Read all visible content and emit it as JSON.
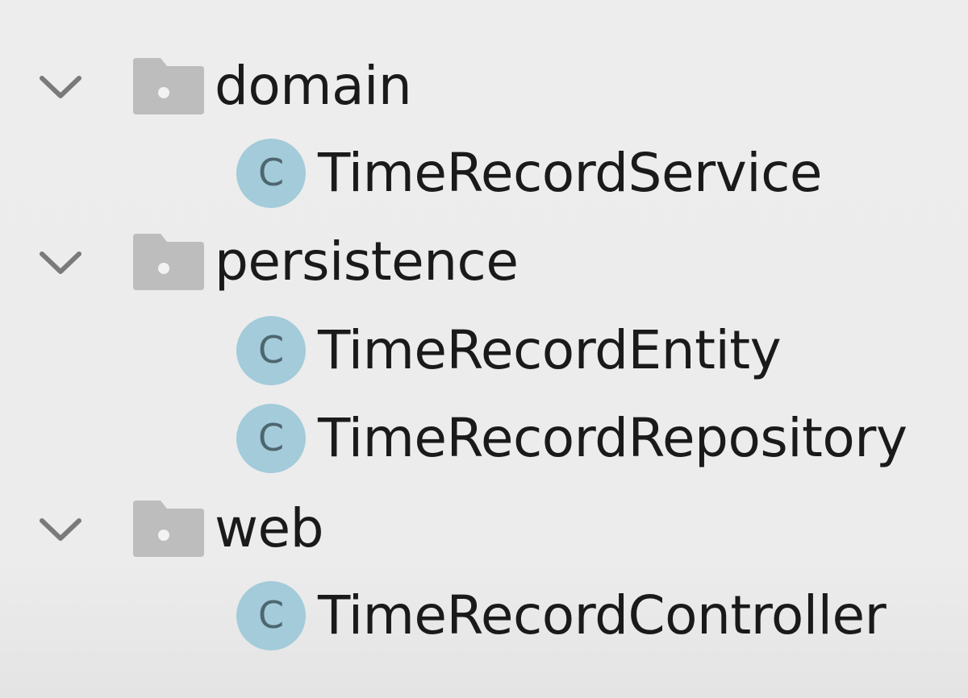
{
  "project_tree": {
    "packages": [
      {
        "name": "domain",
        "expanded_icon": "chevron-down-icon",
        "icon": "folder-package-icon",
        "classes": [
          {
            "name": "TimeRecordService",
            "icon_letter": "C"
          }
        ]
      },
      {
        "name": "persistence",
        "expanded_icon": "chevron-down-icon",
        "icon": "folder-package-icon",
        "classes": [
          {
            "name": "TimeRecordEntity",
            "icon_letter": "C"
          },
          {
            "name": "TimeRecordRepository",
            "icon_letter": "C"
          }
        ]
      },
      {
        "name": "web",
        "expanded_icon": "chevron-down-icon",
        "icon": "folder-package-icon",
        "classes": [
          {
            "name": "TimeRecordController",
            "icon_letter": "C"
          }
        ]
      }
    ]
  },
  "colors": {
    "background": "#ececec",
    "folder_icon": "#bdbdbd",
    "class_icon_fill": "#a3cbd9",
    "class_icon_letter": "#4e6670",
    "text": "#1a1a1a",
    "chevron": "#7a7a7a"
  }
}
